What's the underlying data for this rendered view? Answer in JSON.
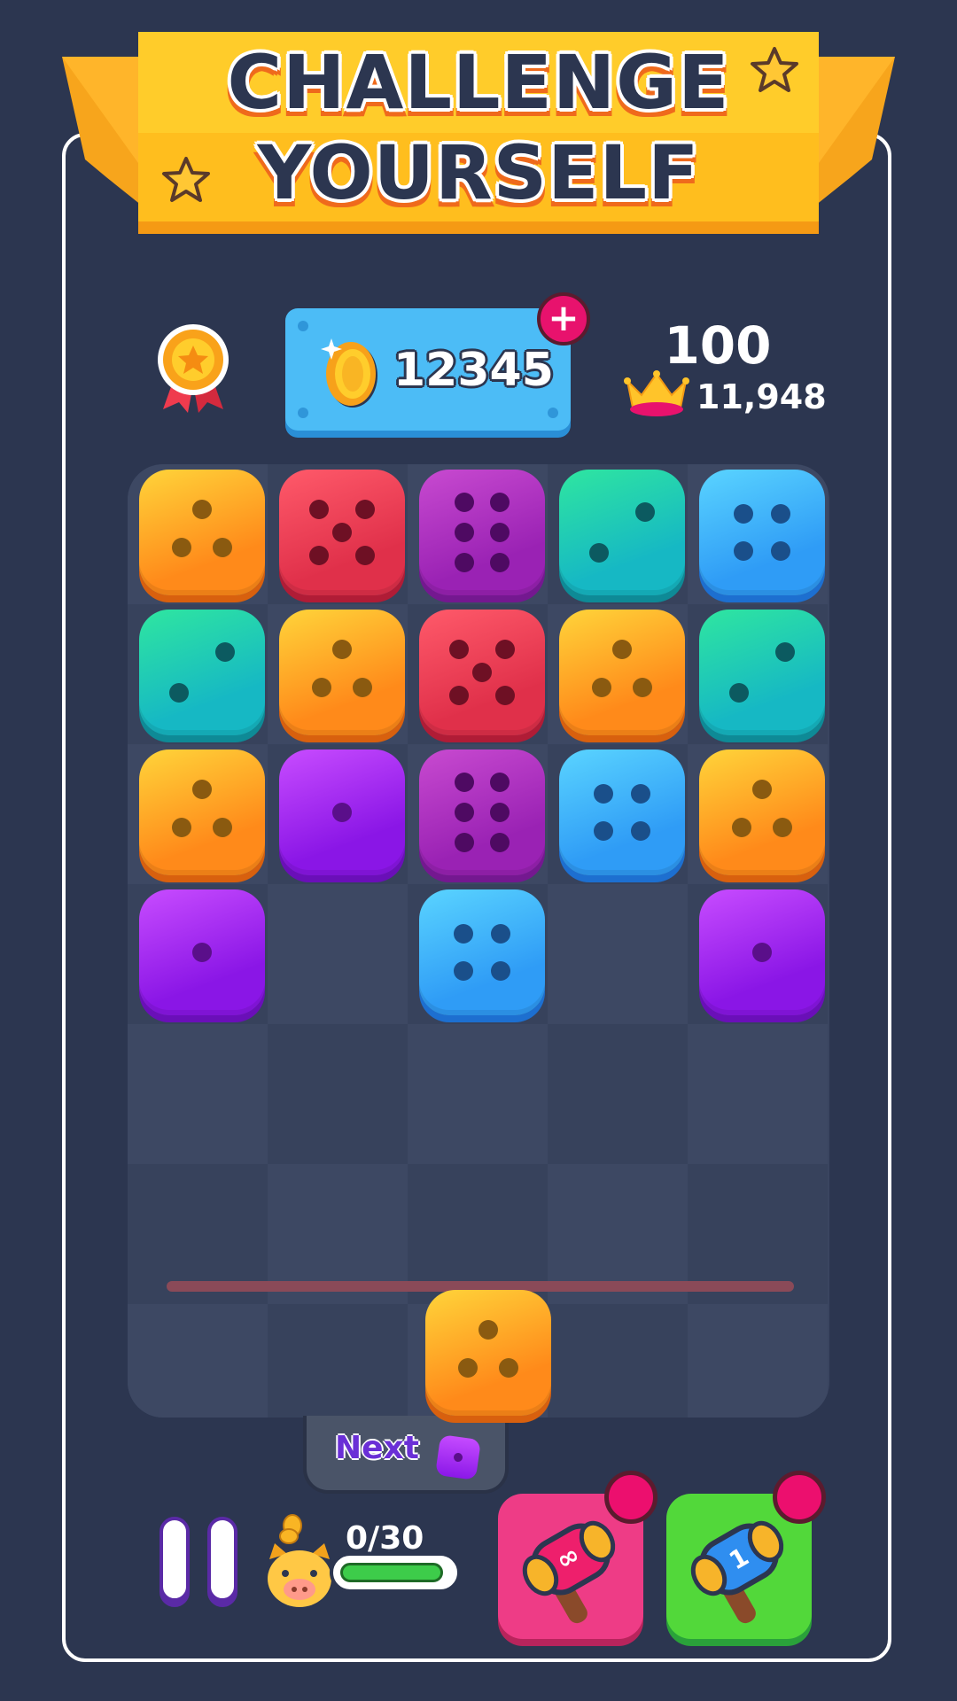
{
  "banner": {
    "line1": "CHALLENGE",
    "line2": "YOURSELF"
  },
  "hud": {
    "medal_icon": "medal-star-icon",
    "coins": "12345",
    "coin_icon": "gold-coin-icon",
    "add_coins_icon": "plus-icon",
    "score": "100",
    "best_score": "11,948",
    "best_icon": "crown-icon"
  },
  "board": {
    "columns": 5,
    "rows": 8,
    "grid": [
      [
        3,
        5,
        6,
        2,
        4
      ],
      [
        2,
        3,
        5,
        3,
        2
      ],
      [
        3,
        1,
        6,
        4,
        3
      ],
      [
        1,
        0,
        4,
        0,
        1
      ]
    ],
    "falling_die": {
      "column": 3,
      "value": 3
    },
    "colors": {
      "1": [
        "#c84cff",
        "#8a16e6",
        "#6a0fb8"
      ],
      "2": [
        "#2fe6a0",
        "#16b8c4",
        "#0e8a96"
      ],
      "3": [
        "#ffd43a",
        "#ff8a1a",
        "#d8600e"
      ],
      "4": [
        "#5ad4ff",
        "#2f9cf6",
        "#1d6fd0"
      ],
      "5": [
        "#ff5a6a",
        "#e0304a",
        "#b01c36"
      ],
      "6": [
        "#c84ad0",
        "#9a22b4",
        "#741890"
      ]
    }
  },
  "next": {
    "label": "Next",
    "value": 1
  },
  "bottom": {
    "pause_icon": "pause-icon",
    "piggy_icon": "piggy-bank-icon",
    "progress_text": "0/30",
    "progress_fraction": 0.0,
    "booster_1_icon": "hammer-infinity-icon",
    "booster_2_icon": "hammer-one-icon"
  }
}
